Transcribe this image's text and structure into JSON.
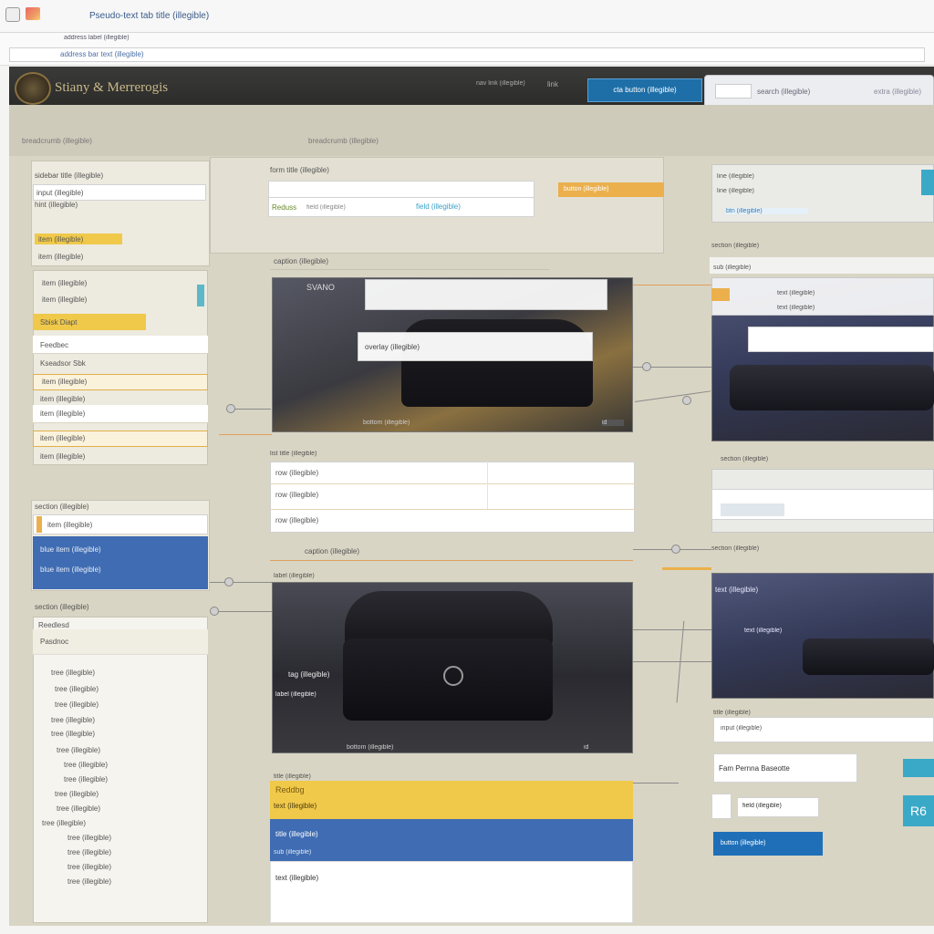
{
  "browser": {
    "tab_title": "Pseudo-text tab title (illegible)",
    "address_label": "address label (illegible)",
    "address_text": "address bar text (illegible)"
  },
  "header": {
    "brand": "Stiany & Merrerogis",
    "nav_link_1": "nav link (illegible)",
    "nav_link_2": "link",
    "cta_label": "cta button (illegible)",
    "search_text": "search (illegible)",
    "search_extra": "extra (illegible)"
  },
  "subbar": {
    "crumb_left": "breadcrumb (illegible)",
    "crumb_mid": "breadcrumb (illegible)"
  },
  "sidebar": {
    "title": "sidebar title (illegible)",
    "input_value": "input (illegible)",
    "hint": "hint (illegible)",
    "items": [
      {
        "label": "item (illegible)"
      },
      {
        "label": "item (illegible)"
      },
      {
        "label": "item (illegible)"
      },
      {
        "label": "item (illegible)"
      },
      {
        "label": "Sbisk Diapt"
      },
      {
        "label": "Feedbec"
      },
      {
        "label": "Kseadsor Sbk"
      },
      {
        "label": "item (illegible)"
      },
      {
        "label": "item (illegible)"
      },
      {
        "label": "item (illegible)"
      }
    ],
    "section_2_title": "section (illegible)",
    "section_2_item": "item (illegible)",
    "section_2_blue_1": "blue item (illegible)",
    "section_2_blue_2": "blue item (illegible)",
    "section_3_title": "section (illegible)",
    "section_3_sub": "Reedlesd",
    "section_3_sub2": "Pasdnoc",
    "tree": [
      "tree (illegible)",
      "tree (illegible)",
      "tree (illegible)",
      "tree (illegible)",
      "tree (illegible)",
      "tree (illegible)",
      "tree (illegible)",
      "tree (illegible)",
      "tree (illegible)",
      "tree (illegible)",
      "tree (illegible)",
      "tree (illegible)",
      "tree (illegible)",
      "tree (illegible)",
      "tree (illegible)"
    ]
  },
  "center": {
    "form_title": "form title (illegible)",
    "form_input_1": "",
    "form_input_2": "Reduss",
    "form_input_2b": "field (illegible)",
    "form_input_2c": "field (illegible)",
    "form_orange": "button (illegible)",
    "photo_1_caption": "caption (illegible)",
    "photo_1_header": "SVANO",
    "photo_1_overlay": "overlay (illegible)",
    "photo_1_bottom": "bottom (illegible)",
    "photo_1_bottom_right": "id",
    "list_title": "list title (illegible)",
    "list_rows": [
      "row (illegible)",
      "row (illegible)",
      "row (illegible)"
    ],
    "photo_2_caption": "caption (illegible)",
    "photo_2_label": "label (illegible)",
    "photo_2_tag": "tag (illegible)",
    "photo_2_bottom": "bottom (illegible)",
    "photo_2_bottom_right": "id",
    "bottom_title": "title (illegible)",
    "yellow_title": "Reddbg",
    "yellow_text": "text (illegible)",
    "blue_title": "title (illegible)",
    "blue_sub": "sub (illegible)",
    "white_text": "text (illegible)"
  },
  "right": {
    "top_line_1": "line (illegible)",
    "top_line_2": "line (illegible)",
    "top_btn": "btn (illegible)",
    "section_1": "section (illegible)",
    "section_1_sub": "sub (illegible)",
    "photo_1_text_1": "text (illegible)",
    "photo_1_text_2": "text (illegible)",
    "section_2": "section (illegible)",
    "section_3": "section (illegible)",
    "photo_2_text_1": "text (illegible)",
    "photo_2_text_2": "text (illegible)",
    "bottom_title": "title (illegible)",
    "bottom_input": "input (illegible)",
    "bottom_field": "Fam Pernna Baseotte",
    "bottom_field_2": "field (illegible)",
    "bottom_blue_btn": "button (illegible)",
    "bottom_teal_small": "",
    "bottom_teal_large": "R6"
  },
  "colors": {
    "header_bg": "#2c2c2a",
    "accent_yellow": "#f0c94a",
    "accent_blue": "#3f6cb2",
    "accent_orange": "#ebb04c",
    "accent_teal": "#3aa9c8",
    "canvas_bg": "#d9d5c4"
  }
}
